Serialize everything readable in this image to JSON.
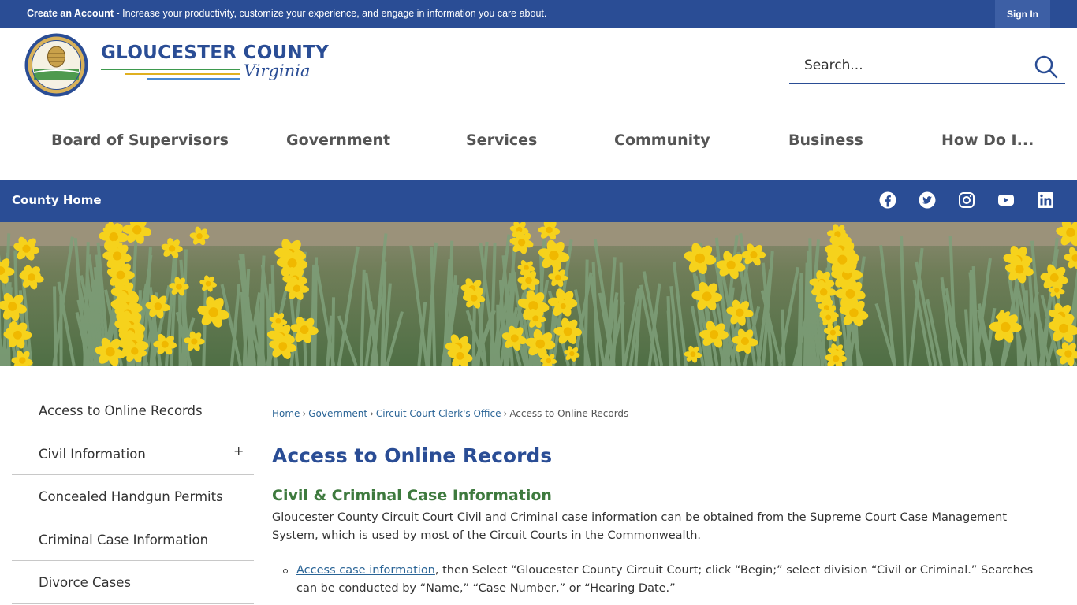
{
  "topbar": {
    "create_account": "Create an Account",
    "message": " - Increase your productivity, customize your experience, and engage in information you care about.",
    "sign_in": "Sign In"
  },
  "header": {
    "title": "GLOUCESTER COUNTY",
    "subtitle": "Virginia",
    "search_placeholder": "Search..."
  },
  "main_nav": [
    {
      "label": "Board of Supervisors"
    },
    {
      "label": "Government"
    },
    {
      "label": "Services"
    },
    {
      "label": "Community"
    },
    {
      "label": "Business"
    },
    {
      "label": "How Do I..."
    }
  ],
  "strip": {
    "county_home": "County Home",
    "social": [
      "facebook-icon",
      "twitter-icon",
      "instagram-icon",
      "youtube-icon",
      "linkedin-icon"
    ]
  },
  "sidenav": [
    {
      "label": "Access to Online Records",
      "expandable": false
    },
    {
      "label": "Civil Information",
      "expandable": true,
      "toggle": "+"
    },
    {
      "label": "Concealed Handgun Permits",
      "expandable": false
    },
    {
      "label": "Criminal Case Information",
      "expandable": false
    },
    {
      "label": "Divorce Cases",
      "expandable": false
    }
  ],
  "breadcrumb": {
    "items": [
      "Home",
      "Government",
      "Circuit Court Clerk's Office"
    ],
    "current": "Access to Online Records",
    "separator": "›"
  },
  "content": {
    "title": "Access to Online Records",
    "section_title": "Civil & Criminal Case Information",
    "paragraph": "Gloucester County Circuit Court Civil and Criminal case information can be obtained from the Supreme Court Case Management System, which is used by most of the Circuit Courts in the Commonwealth.",
    "bullet_link": "Access case information",
    "bullet_text": ", then Select “Gloucester County Circuit Court; click “Begin;” select division “Civil or Criminal.” Searches can be conducted by “Name,” “Case Number,” or “Hearing Date.”"
  },
  "colors": {
    "brand_blue": "#2a4d95",
    "heading_green": "#3e7a3e",
    "link": "#2a6496"
  }
}
